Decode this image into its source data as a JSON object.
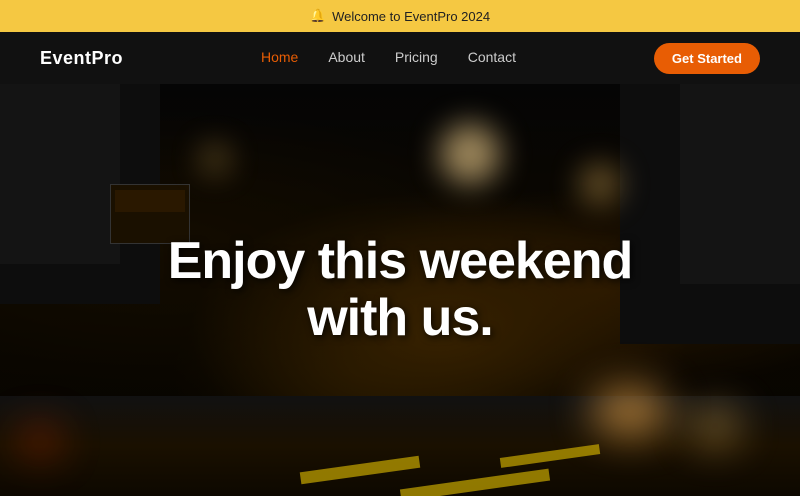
{
  "announcement": {
    "icon": "🔔",
    "text": "Welcome to EventPro 2024"
  },
  "navbar": {
    "logo": "EventPro",
    "links": [
      {
        "label": "Home",
        "active": true
      },
      {
        "label": "About",
        "active": false
      },
      {
        "label": "Pricing",
        "active": false
      },
      {
        "label": "Contact",
        "active": false
      }
    ],
    "cta": "Get Started"
  },
  "hero": {
    "heading_line1": "Enjoy this weekend",
    "heading_line2": "with us."
  },
  "colors": {
    "accent": "#e85d04",
    "announcement_bg": "#f5c842"
  }
}
